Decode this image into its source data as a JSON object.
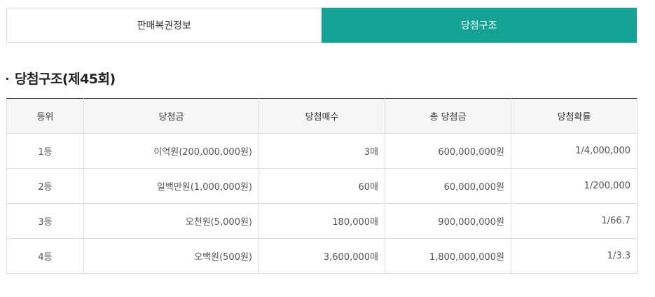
{
  "tabs": [
    {
      "label": "판매복권정보",
      "active": false
    },
    {
      "label": "당첨구조",
      "active": true
    }
  ],
  "section": {
    "title": "당첨구조(제45회)"
  },
  "table": {
    "headers": [
      "등위",
      "당첨금",
      "당첨매수",
      "총 당첨금",
      "당첨확률"
    ],
    "rows": [
      [
        "1등",
        "이억원(200,000,000원)",
        "3매",
        "600,000,000원",
        "1/4,000,000"
      ],
      [
        "2등",
        "일백만원(1,000,000원)",
        "60매",
        "60,000,000원",
        "1/200,000"
      ],
      [
        "3등",
        "오천원(5,000원)",
        "180,000매",
        "900,000,000원",
        "1/66.7"
      ],
      [
        "4등",
        "오백원(500원)",
        "3,600,000매",
        "1,800,000,000원",
        "1/3.3"
      ]
    ]
  },
  "colors": {
    "accent": "#14a295"
  }
}
